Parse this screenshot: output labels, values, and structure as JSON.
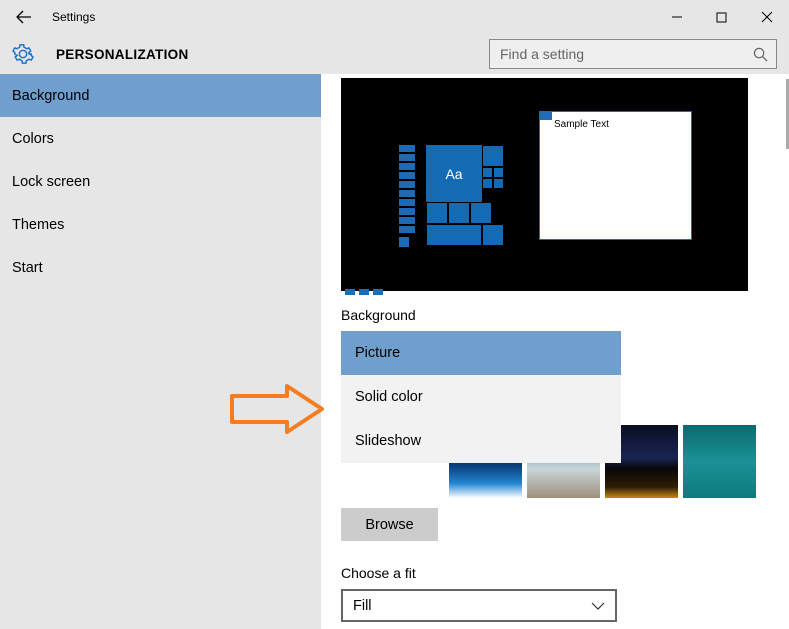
{
  "window": {
    "title": "Settings"
  },
  "header": {
    "section_title": "PERSONALIZATION",
    "search_placeholder": "Find a setting"
  },
  "sidebar": {
    "items": [
      {
        "label": "Background",
        "active": true
      },
      {
        "label": "Colors",
        "active": false
      },
      {
        "label": "Lock screen",
        "active": false
      },
      {
        "label": "Themes",
        "active": false
      },
      {
        "label": "Start",
        "active": false
      }
    ]
  },
  "content": {
    "preview": {
      "sample_text": "Sample Text",
      "tile_label": "Aa"
    },
    "background_label": "Background",
    "dropdown": {
      "selected": "Picture",
      "options": [
        {
          "label": "Picture"
        },
        {
          "label": "Solid color"
        },
        {
          "label": "Slideshow"
        }
      ]
    },
    "browse_label": "Browse",
    "fit_label": "Choose a fit",
    "fit_value": "Fill"
  },
  "annotation": {
    "arrow_color": "#f57c1f"
  }
}
